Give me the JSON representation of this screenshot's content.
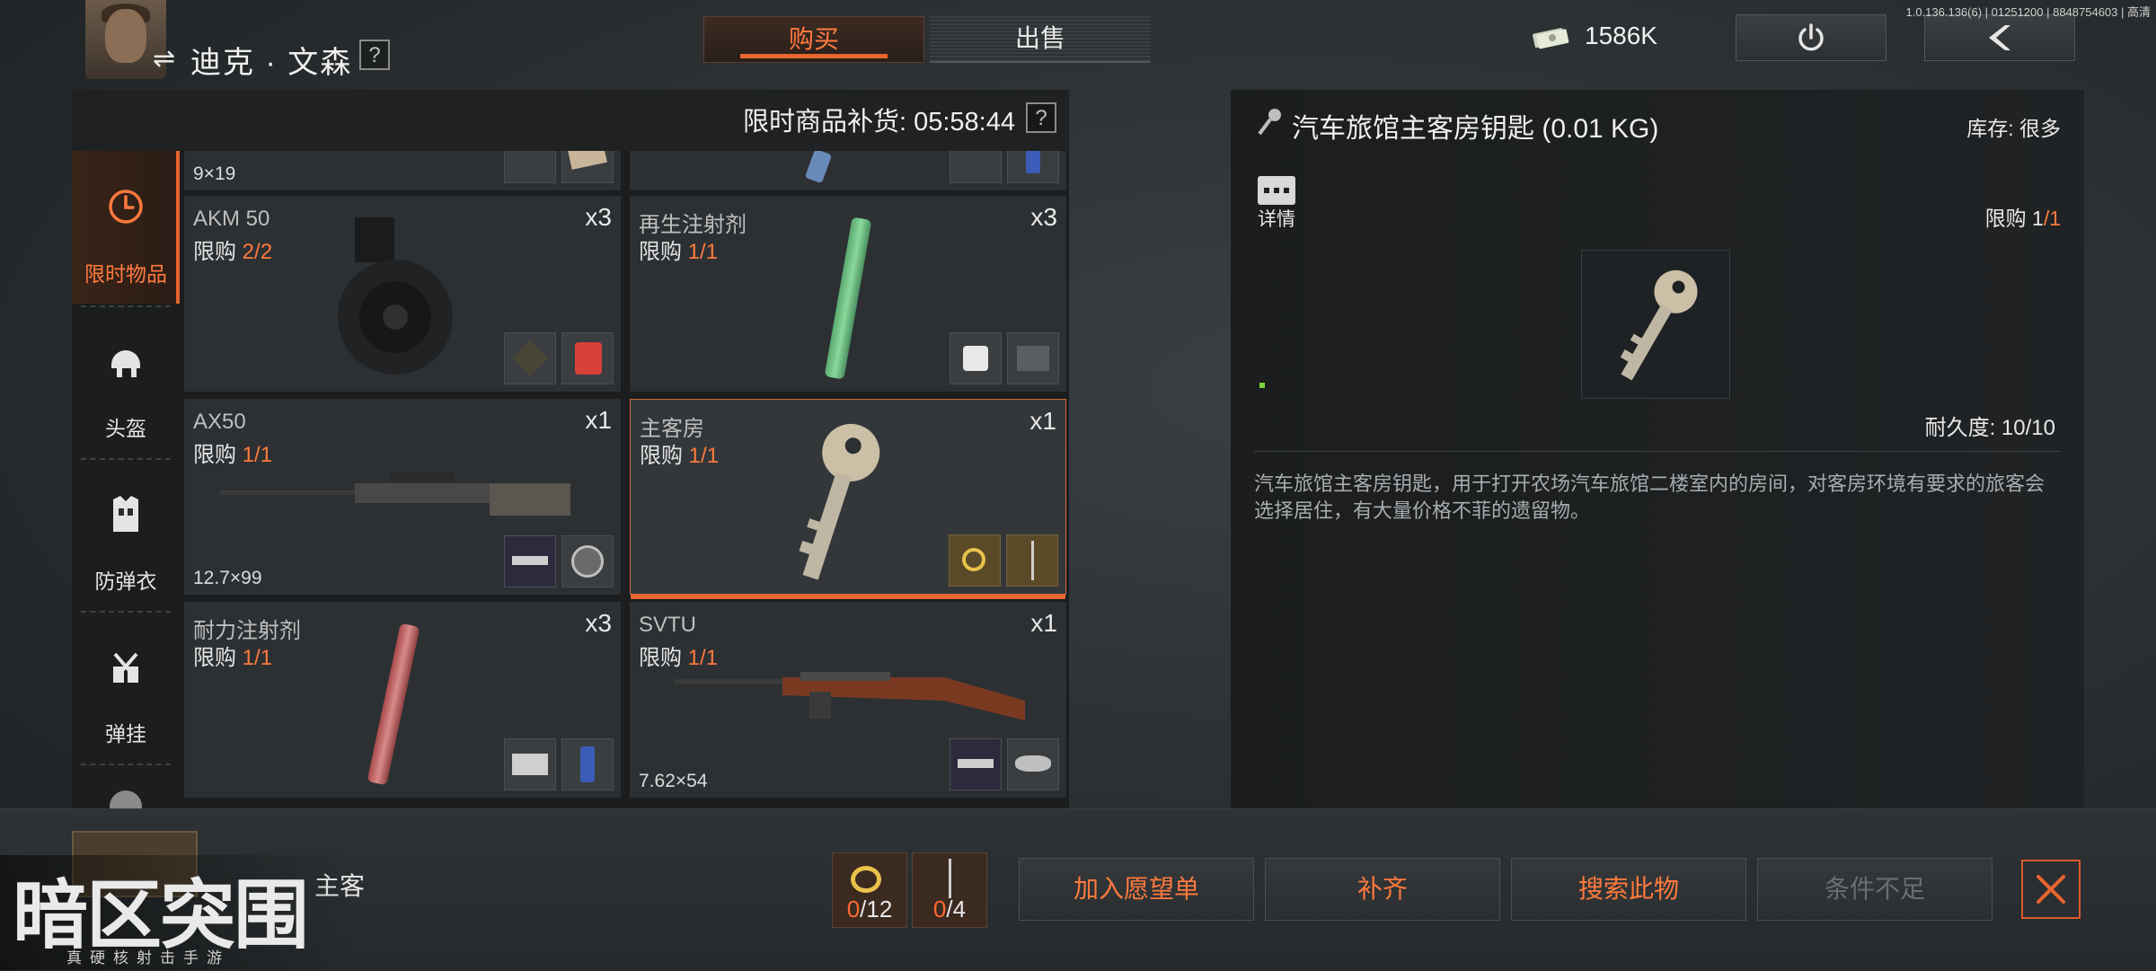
{
  "header": {
    "player_name": "迪克 · 文森",
    "swap_icon": "⇌",
    "help": "?",
    "tabs": [
      {
        "label": "购买",
        "active": true
      },
      {
        "label": "出售",
        "active": false
      }
    ],
    "money": "1586K",
    "version": "1.0.136.136(6) | 01251200 | 8848754603 | 高清"
  },
  "shop": {
    "restock_label": "限时商品补货: 05:58:44",
    "help": "?",
    "categories": [
      {
        "label": "限时物品",
        "icon": "clock-icon",
        "active": true
      },
      {
        "label": "头盔",
        "icon": "helmet-icon",
        "active": false
      },
      {
        "label": "防弹衣",
        "icon": "vest-icon",
        "active": false
      },
      {
        "label": "弹挂",
        "icon": "chest-rig-icon",
        "active": false
      }
    ],
    "partial_top_left_caliber": "9×19",
    "items": [
      {
        "name": "AKM 50",
        "limit_prefix": "限购 ",
        "limit": "2/2",
        "qty": "x3",
        "caliber": "",
        "selected": false
      },
      {
        "name": "再生注射剂",
        "limit_prefix": "限购 ",
        "limit": "1/1",
        "qty": "x3",
        "caliber": "",
        "selected": false
      },
      {
        "name": "AX50",
        "limit_prefix": "限购 ",
        "limit": "1/1",
        "qty": "x1",
        "caliber": "12.7×99",
        "selected": false
      },
      {
        "name": "主客房",
        "limit_prefix": "限购 ",
        "limit": "1/1",
        "qty": "x1",
        "caliber": "",
        "selected": true
      },
      {
        "name": "耐力注射剂",
        "limit_prefix": "限购 ",
        "limit": "1/1",
        "qty": "x3",
        "caliber": "",
        "selected": false
      },
      {
        "name": "SVTU",
        "limit_prefix": "限购 ",
        "limit": "1/1",
        "qty": "x1",
        "caliber": "7.62×54",
        "selected": false
      }
    ]
  },
  "detail": {
    "title": "汽车旅馆主客房钥匙 (0.01 KG)",
    "stock": "库存: 很多",
    "detail_label": "详情",
    "limit_prefix": "限购 ",
    "limit_owned": "1",
    "limit_total": "/1",
    "durability": "耐久度: 10/10",
    "description": "汽车旅馆主客房钥匙，用于打开农场汽车旅馆二楼室内的房间，对客房环境有要求的旅客会选择居住，有大量价格不菲的遗留物。"
  },
  "bottom": {
    "selected_name": "主客",
    "requirements": [
      {
        "icon": "gold-ring-icon",
        "have": "0",
        "need": "/12"
      },
      {
        "icon": "needle-icon",
        "have": "0",
        "need": "/4"
      }
    ],
    "buttons": {
      "wishlist": "加入愿望单",
      "refill": "补齐",
      "search": "搜索此物",
      "condition": "条件不足"
    }
  },
  "logo": {
    "main": "暗区突围",
    "sub": "真硬核射击手游"
  },
  "colors": {
    "accent": "#e8652e",
    "accent_text": "#ff7a3d",
    "panel": "#1b1d1e",
    "card": "#2c3033"
  }
}
